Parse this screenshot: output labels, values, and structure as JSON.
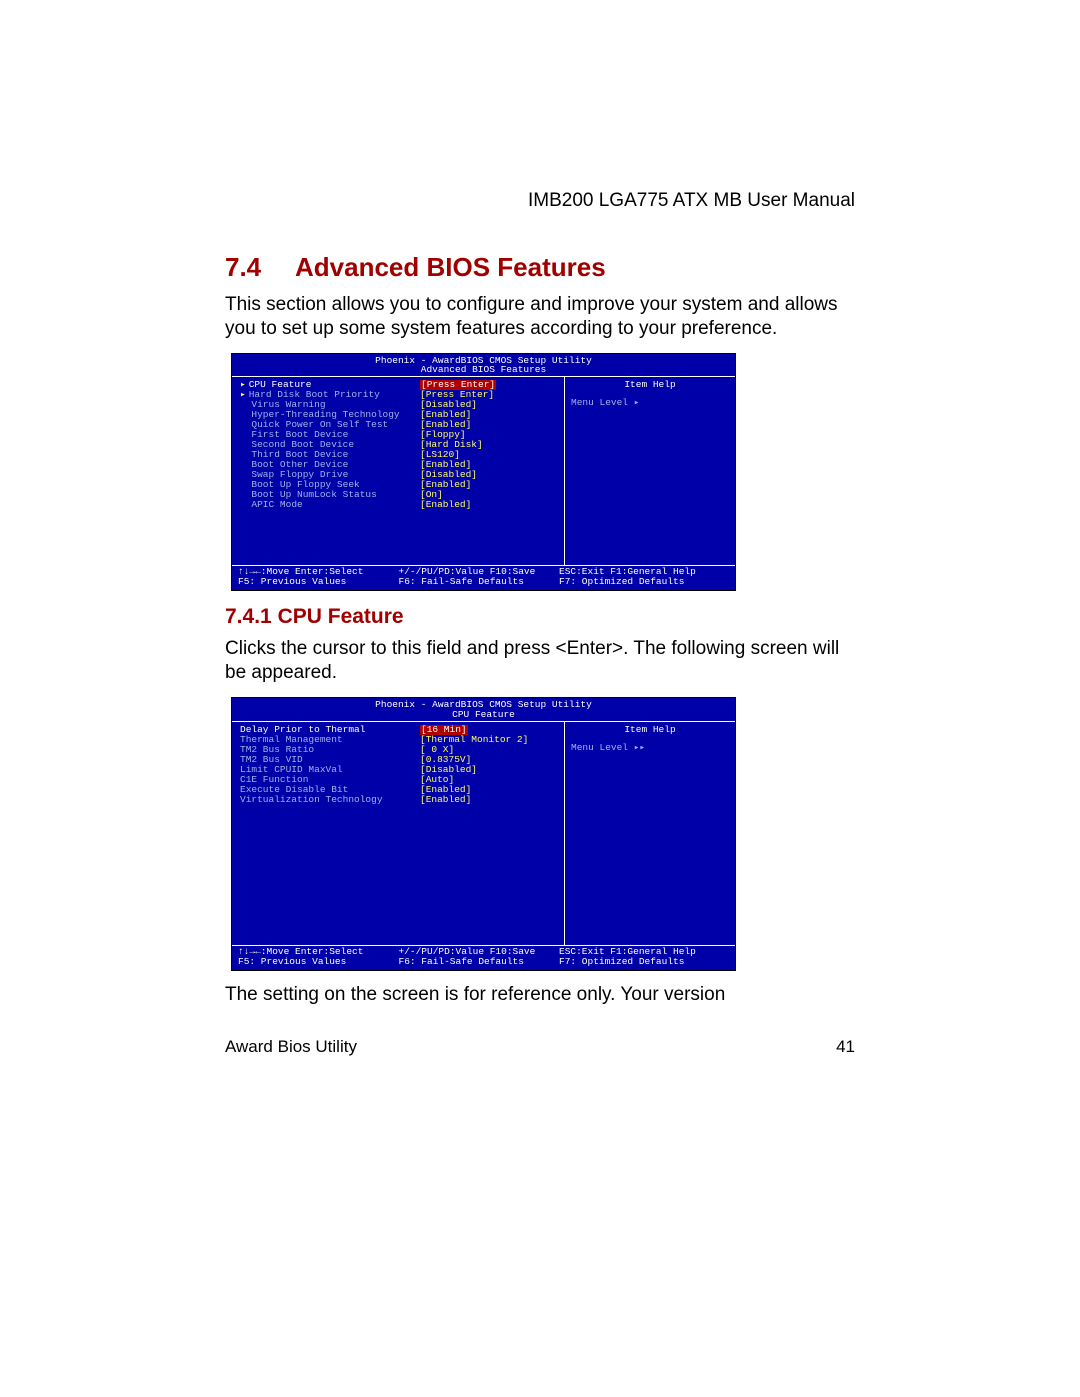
{
  "header": "IMB200 LGA775 ATX MB User Manual",
  "section": {
    "num": "7.4",
    "title": "Advanced BIOS Features"
  },
  "intro": "This section allows you to configure and improve your system and allows you to set up some system features according to your preference.",
  "bios1": {
    "hdr1": "Phoenix - AwardBIOS CMOS Setup Utility",
    "hdr2": "Advanced BIOS Features",
    "rows": [
      {
        "arrow": true,
        "label": "CPU Feature",
        "value": "Press Enter",
        "selected": true
      },
      {
        "arrow": true,
        "label": "Hard Disk Boot Priority",
        "value": "Press Enter"
      },
      {
        "arrow": false,
        "label": "Virus Warning",
        "value": "Disabled"
      },
      {
        "arrow": false,
        "label": "Hyper-Threading Technology",
        "value": "Enabled"
      },
      {
        "arrow": false,
        "label": "Quick Power On Self Test",
        "value": "Enabled"
      },
      {
        "arrow": false,
        "label": "First Boot Device",
        "value": "Floppy"
      },
      {
        "arrow": false,
        "label": "Second Boot Device",
        "value": "Hard Disk"
      },
      {
        "arrow": false,
        "label": "Third Boot Device",
        "value": "LS120"
      },
      {
        "arrow": false,
        "label": "Boot Other Device",
        "value": "Enabled"
      },
      {
        "arrow": false,
        "label": "Swap Floppy Drive",
        "value": "Disabled"
      },
      {
        "arrow": false,
        "label": "Boot Up Floppy Seek",
        "value": "Enabled"
      },
      {
        "arrow": false,
        "label": "Boot Up NumLock Status",
        "value": "On"
      },
      {
        "arrow": false,
        "label": "APIC Mode",
        "value": "Enabled"
      }
    ],
    "help_title": "Item Help",
    "menu_level": "Menu Level   ▸",
    "foot1": {
      "l": "↑↓→←:Move  Enter:Select",
      "c": "+/-/PU/PD:Value  F10:Save",
      "r": "ESC:Exit  F1:General Help"
    },
    "foot2": {
      "l": "F5: Previous Values",
      "c": "F6: Fail-Safe Defaults",
      "r": "F7: Optimized Defaults"
    }
  },
  "sub": {
    "num": "7.4.1",
    "title": "CPU Feature"
  },
  "subtext": "Clicks the cursor to this field and press <Enter>. The following screen will be appeared.",
  "bios2": {
    "hdr1": "Phoenix - AwardBIOS CMOS Setup Utility",
    "hdr2": "CPU Feature",
    "rows": [
      {
        "label": "Delay Prior to Thermal",
        "value": "16 Min",
        "selected": true
      },
      {
        "label": "Thermal Management",
        "value": "Thermal Monitor 2"
      },
      {
        "label": "TM2 Bus Ratio",
        "value": " 0 X"
      },
      {
        "label": "TM2 Bus VID",
        "value": "0.8375V"
      },
      {
        "label": "Limit CPUID MaxVal",
        "value": "Disabled"
      },
      {
        "label": "C1E Function",
        "value": "Auto"
      },
      {
        "label": "Execute Disable Bit",
        "value": "Enabled"
      },
      {
        "label": "Virtualization Technology",
        "value": "Enabled"
      }
    ],
    "help_title": "Item Help",
    "menu_level": "Menu Level   ▸▸",
    "foot1": {
      "l": "↑↓→←:Move  Enter:Select",
      "c": "+/-/PU/PD:Value  F10:Save",
      "r": "ESC:Exit  F1:General Help"
    },
    "foot2": {
      "l": "F5: Previous Values",
      "c": "F6: Fail-Safe Defaults",
      "r": "F7: Optimized Defaults"
    }
  },
  "tail": "The setting on the screen is for reference only. Your version",
  "footer": {
    "left": "Award Bios Utility",
    "right": "41"
  }
}
